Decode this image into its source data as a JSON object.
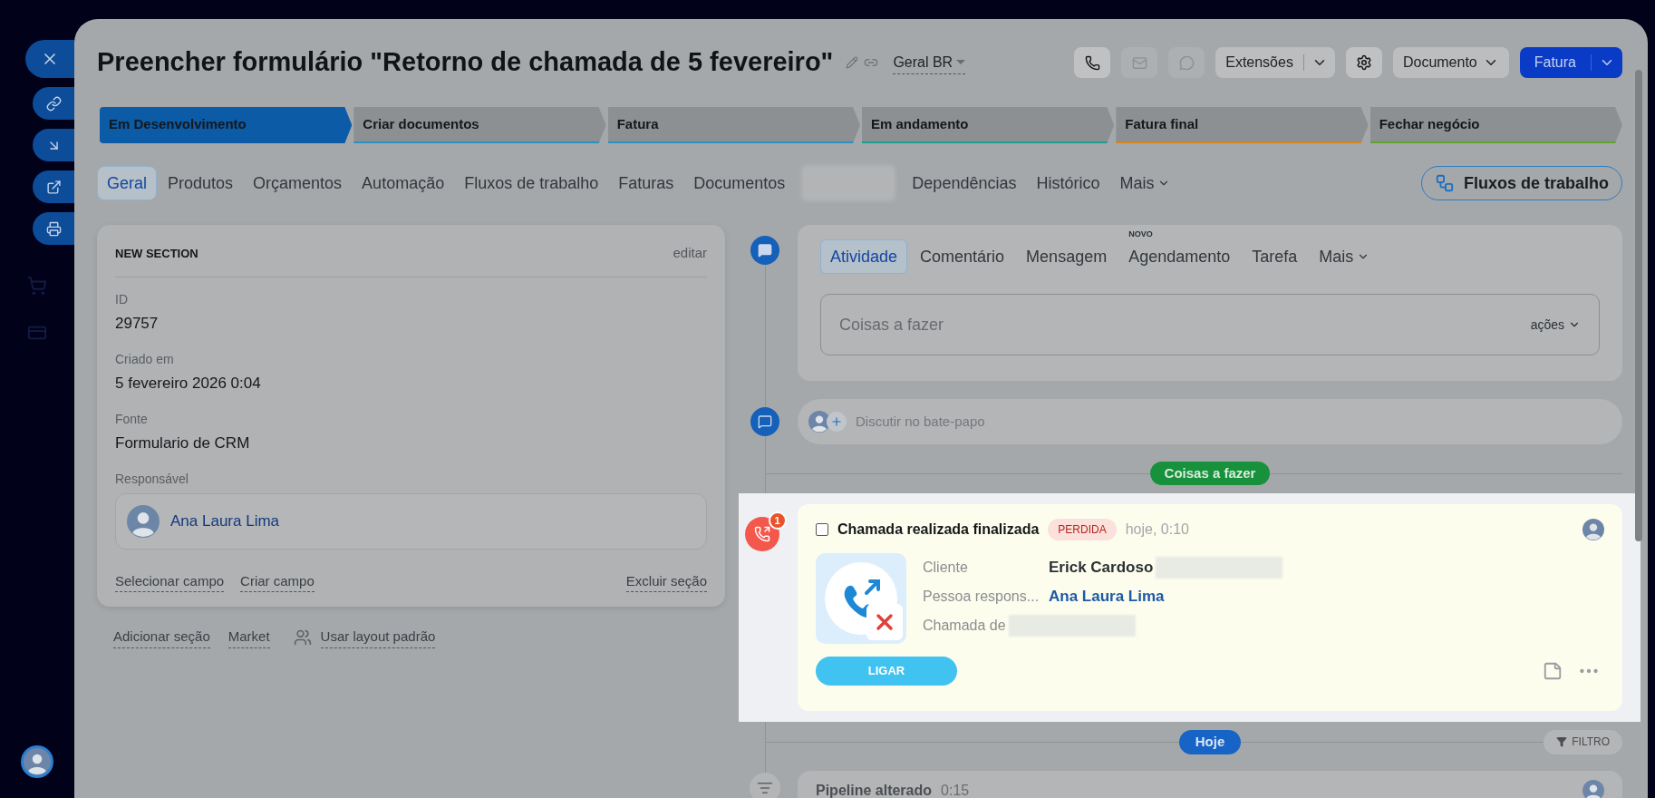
{
  "title": "Preencher formulário \"Retorno de chamada de 5 fevereiro\"",
  "category": "Geral BR",
  "header_icons": [
    {
      "kind": "call",
      "disabled": false
    },
    {
      "kind": "mail",
      "disabled": true
    },
    {
      "kind": "chat",
      "disabled": true
    }
  ],
  "extensions_button": "Extensões",
  "document_button": "Documento",
  "invoice_button": "Fatura",
  "stages": [
    {
      "label": "Em Desenvolvimento",
      "selected": true,
      "color": "#0b5ba6"
    },
    {
      "label": "Criar documentos",
      "selected": false,
      "color": "#2a92c4"
    },
    {
      "label": "Fatura",
      "selected": false,
      "color": "#2a92c4"
    },
    {
      "label": "Em andamento",
      "selected": false,
      "color": "#1c9e8e"
    },
    {
      "label": "Fatura final",
      "selected": false,
      "color": "#d9831c"
    },
    {
      "label": "Fechar negócio",
      "selected": false,
      "color": "#5ea52a"
    }
  ],
  "tabs": [
    {
      "kind": "tab",
      "label": "Geral",
      "selected": true
    },
    {
      "kind": "tab",
      "label": "Produtos",
      "selected": false
    },
    {
      "kind": "tab",
      "label": "Orçamentos",
      "selected": false
    },
    {
      "kind": "tab",
      "label": "Automação",
      "selected": false
    },
    {
      "kind": "tab",
      "label": "Fluxos de trabalho",
      "selected": false
    },
    {
      "kind": "tab",
      "label": "Faturas",
      "selected": false
    },
    {
      "kind": "tab",
      "label": "Documentos",
      "selected": false
    },
    {
      "kind": "redacted",
      "selected": false
    },
    {
      "kind": "tab",
      "label": "Dependências",
      "selected": false
    },
    {
      "kind": "tab",
      "label": "Histórico",
      "selected": false
    },
    {
      "kind": "menu",
      "label": "Mais",
      "selected": false
    }
  ],
  "workflows_button": "Fluxos de trabalho",
  "section": {
    "title": "NEW SECTION",
    "edit": "editar",
    "fields": [
      {
        "kind": "text",
        "label": "ID",
        "value": "29757"
      },
      {
        "kind": "text",
        "label": "Criado em",
        "value": "5 fevereiro 2026 0:04"
      },
      {
        "kind": "text",
        "label": "Fonte",
        "value": "Formulario de CRM"
      },
      {
        "kind": "user",
        "label": "Responsável",
        "value": "Ana Laura Lima"
      }
    ],
    "links": [
      "Selecionar campo",
      "Criar campo"
    ],
    "delete": "Excluir seção"
  },
  "section_actions": [
    {
      "kind": "link",
      "label": "Adicionar seção"
    },
    {
      "kind": "link",
      "label": "Market"
    },
    {
      "kind": "layout",
      "label": "Usar layout padrão"
    }
  ],
  "composer": {
    "tabs": [
      {
        "kind": "tab",
        "label": "Atividade",
        "selected": true
      },
      {
        "kind": "tab",
        "label": "Comentário",
        "selected": false
      },
      {
        "kind": "tab",
        "label": "Mensagem",
        "selected": false
      },
      {
        "kind": "tab",
        "label": "Agendamento",
        "selected": false,
        "badge": "NOVO"
      },
      {
        "kind": "tab",
        "label": "Tarefa",
        "selected": false
      },
      {
        "kind": "menu",
        "label": "Mais",
        "selected": false
      }
    ],
    "placeholder": "Coisas a fazer",
    "actions": "ações"
  },
  "chat": {
    "placeholder": "Discutir no bate-papo"
  },
  "todo_label": "Coisas a fazer",
  "activity": {
    "badge": "1",
    "checked": false,
    "title": "Chamada realizada finalizada",
    "status": "PERDIDA",
    "time": "hoje, 0:10",
    "fields": [
      {
        "kind": "text",
        "label": "Cliente",
        "value": "Erick Cardoso",
        "redacted": true
      },
      {
        "kind": "link",
        "label": "Pessoa respons...",
        "value": "Ana Laura Lima",
        "redacted": false
      },
      {
        "label": "Chamada de",
        "redacted": true
      }
    ],
    "call_button": "LIGAR"
  },
  "today_label": "Hoje",
  "filter_button": "FILTRO",
  "next_item": {
    "title": "Pipeline alterado",
    "time": "0:15"
  }
}
